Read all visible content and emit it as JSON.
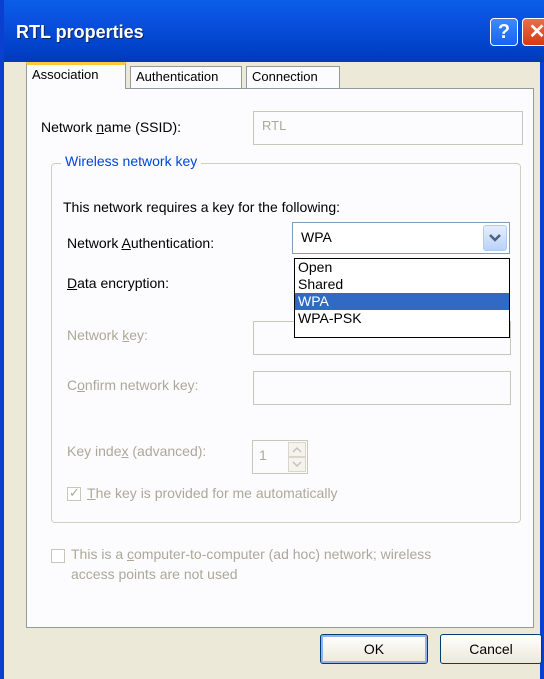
{
  "window": {
    "title": "RTL properties",
    "help_glyph": "?",
    "close_glyph": "✕"
  },
  "tabs": [
    {
      "label": "Association",
      "active": true
    },
    {
      "label": "Authentication",
      "active": false
    },
    {
      "label": "Connection",
      "active": false
    }
  ],
  "association": {
    "ssid_label_pre": "Network ",
    "ssid_label_key": "n",
    "ssid_label_post": "ame (SSID):",
    "ssid_value": "RTL",
    "group_title": "Wireless network key",
    "requires_key_text": "This network requires a key for the following:",
    "auth_label_pre": "Network ",
    "auth_label_key": "A",
    "auth_label_post": "uthentication:",
    "auth_selected": "WPA",
    "auth_options": [
      "Open",
      "Shared",
      "WPA",
      "WPA-PSK"
    ],
    "enc_label_key": "D",
    "enc_label_post": "ata encryption:",
    "netkey_label_pre": "Network ",
    "netkey_label_key": "k",
    "netkey_label_post": "ey:",
    "confirm_label_pre": "C",
    "confirm_label_key": "o",
    "confirm_label_post": "nfirm network key:",
    "keyindex_label_pre": "Key inde",
    "keyindex_label_key": "x",
    "keyindex_label_post": " (advanced):",
    "keyindex_value": "1",
    "auto_key_label_pre": "",
    "auto_key_label_key": "T",
    "auto_key_label_post": "he key is provided for me automatically",
    "auto_key_checked": true,
    "adhoc_label_line1_pre": "This is a ",
    "adhoc_label_line1_key": "c",
    "adhoc_label_line1_post": "omputer-to-computer (ad hoc) network; wireless",
    "adhoc_label_line2": "access points are not used",
    "adhoc_checked": false
  },
  "buttons": {
    "ok": "OK",
    "cancel": "Cancel"
  },
  "colors": {
    "titlebar": "#0054e3",
    "accent_tab": "#ffc83c",
    "selection": "#316ac5",
    "group_title": "#0046d5"
  }
}
